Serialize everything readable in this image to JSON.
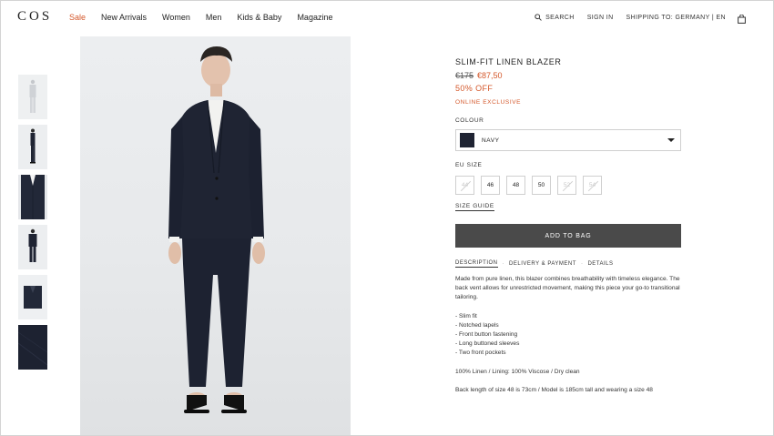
{
  "header": {
    "logo": "COS",
    "nav": [
      "Sale",
      "New Arrivals",
      "Women",
      "Men",
      "Kids & Baby",
      "Magazine"
    ],
    "search_label": "SEARCH",
    "sign_in_label": "SIGN IN",
    "shipping_label": "SHIPPING TO: GERMANY | EN",
    "bag_icon": "bag-icon"
  },
  "gallery": {
    "thumbnails": [
      "front-view",
      "side-view",
      "jacket-detail",
      "back-view",
      "folded-jacket",
      "fabric-detail"
    ]
  },
  "product": {
    "title": "SLIM-FIT LINEN BLAZER",
    "old_price": "€175",
    "new_price": "€87,50",
    "discount": "50% OFF",
    "exclusive": "ONLINE EXCLUSIVE",
    "colour_label": "COLOUR",
    "colour_value": "NAVY",
    "colour_hex": "#1f2433",
    "size_label": "EU SIZE",
    "sizes": [
      {
        "label": "44",
        "available": false
      },
      {
        "label": "46",
        "available": true
      },
      {
        "label": "48",
        "available": true
      },
      {
        "label": "50",
        "available": true
      },
      {
        "label": "52",
        "available": false
      },
      {
        "label": "54",
        "available": false
      }
    ],
    "size_guide": "SIZE GUIDE",
    "add_to_bag": "ADD TO BAG",
    "tabs": [
      "DESCRIPTION",
      "DELIVERY & PAYMENT",
      "DETAILS"
    ],
    "description": "Made from pure linen, this blazer combines breathability with timeless elegance. The back vent allows for unrestricted movement, making this piece your go-to transitional tailoring.",
    "features": [
      "- Slim fit",
      "- Notched lapels",
      "- Front button fastening",
      "- Long buttoned sleeves",
      "- Two front pockets"
    ],
    "composition": "100% Linen / Lining: 100% Viscose / Dry clean",
    "fit_note": "Back length of size 48 is 73cm / Model is 185cm tall and wearing a size 48"
  },
  "colors": {
    "accent": "#d4572a",
    "button": "#4a4a4a"
  }
}
